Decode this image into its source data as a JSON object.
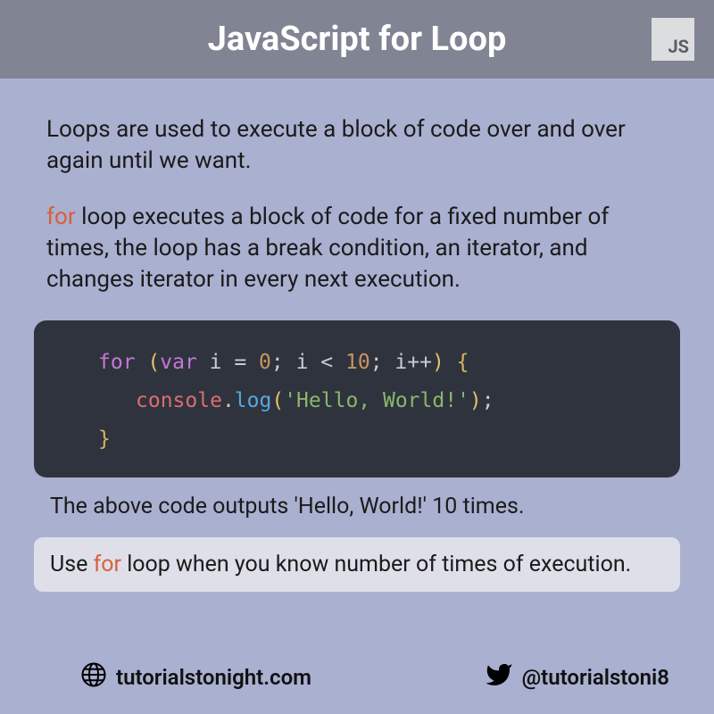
{
  "header": {
    "title": "JavaScript for Loop",
    "badge": "JS"
  },
  "intro": {
    "p1": "Loops are used to execute a block of code over and over again until we want.",
    "p2_pre": "",
    "p2_kw": "for",
    "p2_post": " loop executes a block of code for a fixed number of times, the loop has a break condition, an iterator, and changes iterator in every next execution."
  },
  "code": {
    "kw_for": "for",
    "paren_open": " (",
    "kw_var": "var",
    "decl": " i = ",
    "zero": "0",
    "semi1": "; i < ",
    "ten": "10",
    "semi2": "; i++",
    "paren_close": ")",
    "brace_open": " {",
    "console": "console",
    "dot": ".",
    "log": "log",
    "call_open": "(",
    "str": "'Hello, World!'",
    "call_close": ")",
    "line_end": ";",
    "brace_close": "}"
  },
  "output_text": "The above code outputs  'Hello, World!' 10 times.",
  "tip": {
    "pre": "Use ",
    "kw": "for",
    "post": " loop when you know number of times of execution."
  },
  "footer": {
    "site": "tutorialstonight.com",
    "handle": "@tutorialstoni8"
  }
}
